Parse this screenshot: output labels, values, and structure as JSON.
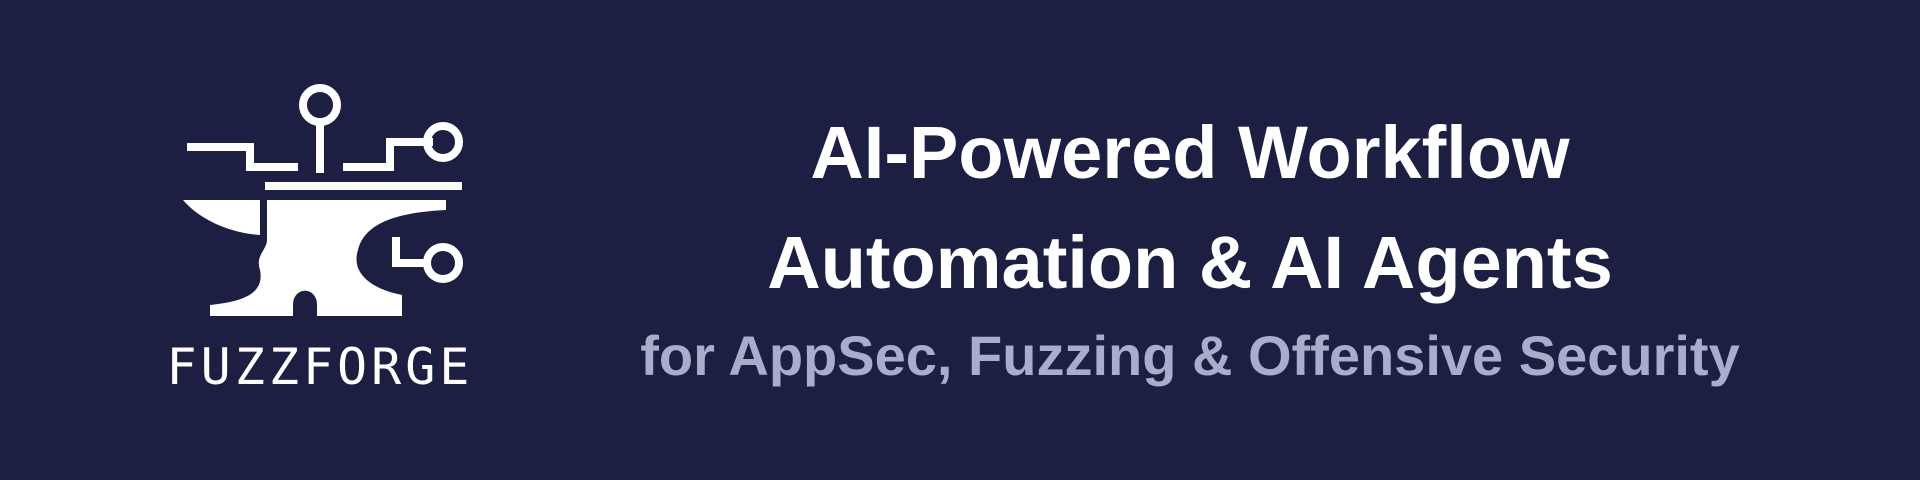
{
  "brand": {
    "name": "FUZZFORGE",
    "logo_icon": "anvil-circuit-icon"
  },
  "headline": {
    "line1": "AI-Powered Workflow",
    "line2": "Automation & AI Agents",
    "subtitle": "for AppSec, Fuzzing & Offensive Security"
  },
  "colors": {
    "background": "#1c1e42",
    "primary_text": "#ffffff",
    "subtitle_text": "#aaaccb"
  }
}
